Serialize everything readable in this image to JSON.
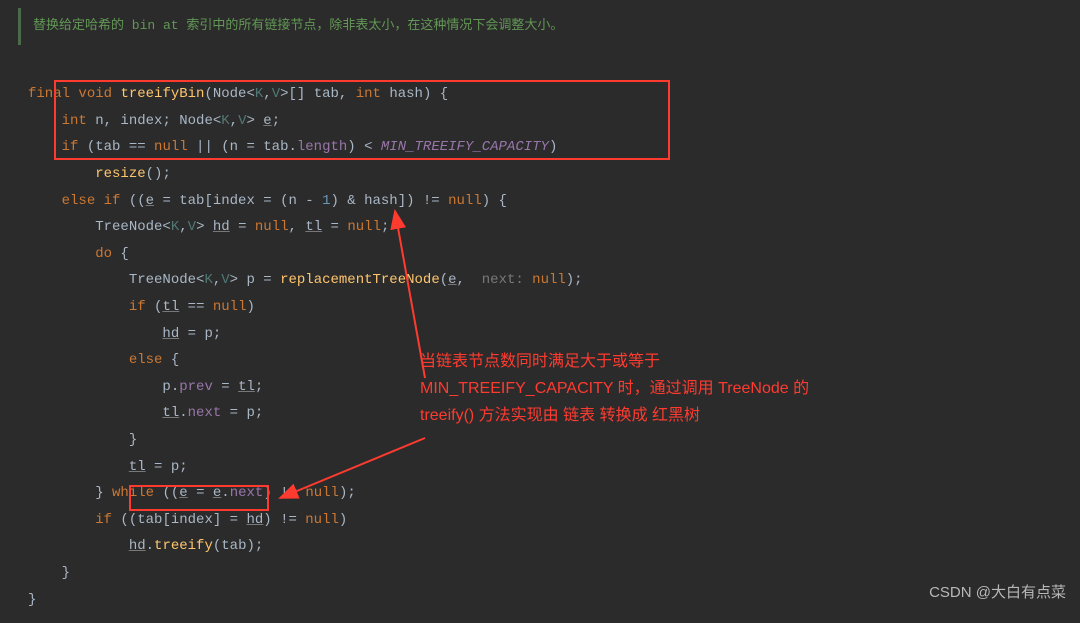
{
  "comment": "替换给定哈希的 bin at 索引中的所有链接节点，除非表太小，在这种情况下会调整大小。",
  "code": {
    "l1": {
      "kw1": "final",
      "kw2": "void",
      "method": "treeifyBin",
      "p1a": "(Node<",
      "gen1": "K",
      "comma1": ",",
      "gen2": "V",
      "p1b": ">[] tab, ",
      "kw3": "int",
      "p2": " hash) {"
    },
    "l2": {
      "kw": "int",
      "txt1": " n, index; Node<",
      "gen1": "K",
      "comma": ",",
      "gen2": "V",
      "txt2": "> ",
      "var": "e",
      "semi": ";"
    },
    "l3": {
      "kw": "if",
      "txt1": " (tab == ",
      "null1": "null",
      "txt2": " || (n = tab.",
      "field": "length",
      "txt3": ") < ",
      "const": "MIN_TREEIFY_CAPACITY",
      "txt4": ")"
    },
    "l4": {
      "method": "resize",
      "txt": "();"
    },
    "l5": {
      "kw": "else if",
      "txt1": " ((",
      "var": "e",
      "txt2": " = tab[index = (n - ",
      "num": "1",
      "txt3": ") & hash]) != ",
      "null": "null",
      "txt4": ") {"
    },
    "l6": {
      "txt1": "TreeNode<",
      "gen1": "K",
      "comma": ",",
      "gen2": "V",
      "txt2": "> ",
      "var1": "hd",
      "txt3": " = ",
      "null1": "null",
      "txt4": ", ",
      "var2": "tl",
      "txt5": " = ",
      "null2": "null",
      "txt6": ";"
    },
    "l7": {
      "kw": "do",
      "txt": " {"
    },
    "l8": {
      "txt1": "TreeNode<",
      "gen1": "K",
      "comma": ",",
      "gen2": "V",
      "txt2": "> p = ",
      "method": "replacementTreeNode",
      "txt3": "(",
      "var": "e",
      "txt4": ", ",
      "hint": " next: ",
      "null": "null",
      "txt5": ");"
    },
    "l9": {
      "kw": "if",
      "txt1": " (",
      "var": "tl",
      "txt2": " == ",
      "null": "null",
      "txt3": ")"
    },
    "l10": {
      "var": "hd",
      "txt": " = p;"
    },
    "l11": {
      "kw": "else",
      "txt": " {"
    },
    "l12": {
      "txt1": "p.",
      "field": "prev",
      "txt2": " = ",
      "var": "tl",
      "txt3": ";"
    },
    "l13": {
      "var": "tl",
      "txt1": ".",
      "field": "next",
      "txt2": " = p;"
    },
    "l14": {
      "txt": "}"
    },
    "l15": {
      "var": "tl",
      "txt": " = p;"
    },
    "l16": {
      "txt1": "} ",
      "kw": "while",
      "txt2": " ((",
      "var1": "e",
      "txt3": " = ",
      "var2": "e",
      "txt4": ".",
      "field": "next",
      "txt5": ") != ",
      "null": "null",
      "txt6": ");"
    },
    "l17": {
      "kw": "if",
      "txt1": " ((tab[index] = ",
      "var": "hd",
      "txt2": ") != ",
      "null": "null",
      "txt3": ")"
    },
    "l18": {
      "var": "hd",
      "txt1": ".",
      "method": "treeify",
      "txt2": "(tab);"
    },
    "l19": {
      "txt": "}"
    },
    "l20": {
      "txt": "}"
    }
  },
  "annotation": {
    "line1": "当链表节点数同时满足大于或等于",
    "line2": "MIN_TREEIFY_CAPACITY 时，通过调用 TreeNode 的",
    "line3": "treeify() 方法实现由 链表 转换成 红黑树"
  },
  "watermark": "CSDN @大白有点菜"
}
